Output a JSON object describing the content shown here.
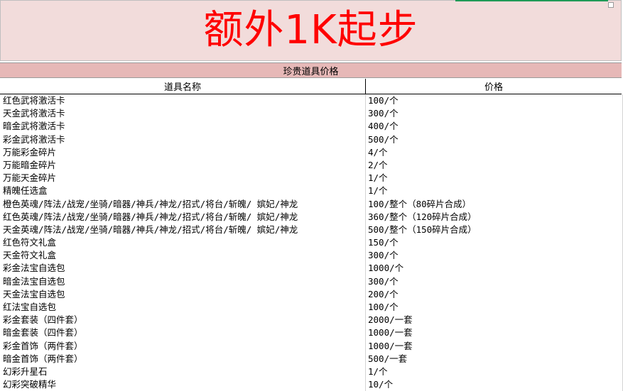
{
  "banner": {
    "title": "额外1K起步",
    "title_color": "#ff0000",
    "background": "#f2dcdb"
  },
  "section": {
    "title": "珍贵道具价格",
    "background": "#e6b8b7"
  },
  "table": {
    "headers": [
      "道具名称",
      "价格"
    ],
    "rows": [
      [
        "红色武将激活卡",
        "100/个"
      ],
      [
        "天金武将激活卡",
        "300/个"
      ],
      [
        "暗金武将激活卡",
        "400/个"
      ],
      [
        "彩金武将激活卡",
        "500/个"
      ],
      [
        "万能彩金碎片",
        "4/个"
      ],
      [
        "万能暗金碎片",
        "2/个"
      ],
      [
        "万能天金碎片",
        "1/个"
      ],
      [
        "精魄任选盒",
        "1/个"
      ],
      [
        "橙色英魂/阵法/战宠/坐骑/暗器/神兵/神龙/招式/将台/斩魄/ 嫔妃/神龙",
        "100/整个（80碎片合成）"
      ],
      [
        "红色英魂/阵法/战宠/坐骑/暗器/神兵/神龙/招式/将台/斩魄/ 嫔妃/神龙",
        "360/整个（120碎片合成）"
      ],
      [
        "天金英魂/阵法/战宠/坐骑/暗器/神兵/神龙/招式/将台/斩魄/ 嫔妃/神龙",
        "500/整个（150碎片合成）"
      ],
      [
        "红色符文礼盒",
        "150/个"
      ],
      [
        "天金符文礼盒",
        "300/个"
      ],
      [
        "彩金法宝自选包",
        "1000/个"
      ],
      [
        "暗金法宝自选包",
        "300/个"
      ],
      [
        "天金法宝自选包",
        "200/个"
      ],
      [
        "红法宝自选包",
        "100/个"
      ],
      [
        "彩金套装（四件套）",
        "2000/一套"
      ],
      [
        "暗金套装（四件套）",
        "1000/一套"
      ],
      [
        "彩金首饰（两件套）",
        "1000/一套"
      ],
      [
        "暗金首饰（两件套）",
        "500/一套"
      ],
      [
        "幻彩升星石",
        "1/个"
      ],
      [
        "幻彩突破精华",
        "10/个"
      ]
    ]
  }
}
